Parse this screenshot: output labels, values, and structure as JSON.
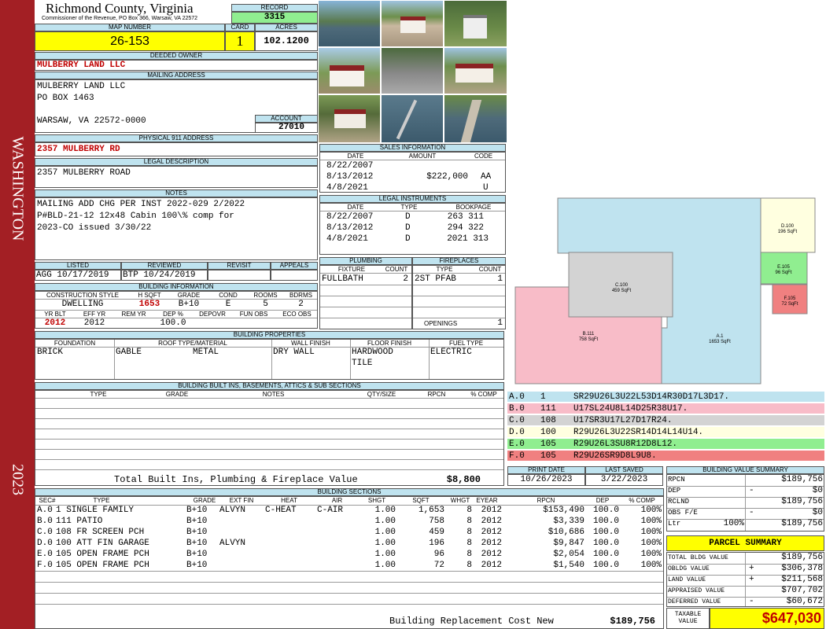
{
  "sidebar": {
    "district": "WASHINGTON",
    "year": "2023",
    "color": "#a31f24"
  },
  "header": {
    "county": "Richmond County, Virginia",
    "commissioner": "Commissioner of the Revenue, PO Box 366, Warsaw, VA 22572"
  },
  "record": {
    "label": "RECORD",
    "value": "3315"
  },
  "map": {
    "label": "MAP NUMBER",
    "value": "26-153"
  },
  "card": {
    "label": "CARD",
    "value": "1"
  },
  "acres": {
    "label": "ACRES",
    "value": "102.1200"
  },
  "owner": {
    "label": "DEEDED OWNER",
    "value": "MULBERRY LAND LLC"
  },
  "mailing": {
    "label": "MAILING ADDRESS",
    "line1": "MULBERRY LAND LLC",
    "line2": "PO BOX 1463",
    "line3": "WARSAW, VA 22572-0000"
  },
  "account": {
    "label": "ACCOUNT",
    "value": "27010"
  },
  "physical": {
    "label": "PHYSICAL 911 ADDRESS",
    "value": "2357 MULBERRY RD"
  },
  "legal": {
    "label": "LEGAL DESCRIPTION",
    "value": "2357 MULBERRY ROAD"
  },
  "notes": {
    "label": "NOTES",
    "line1": "MAILING ADD CHG PER INST 2022-029 2/2022",
    "line2": "P#BLD-21-12 12x48 Cabin 100\\% comp for",
    "line3": "2023-CO issued 3/30/22"
  },
  "sales": {
    "label": "SALES INFORMATION",
    "h_date": "DATE",
    "h_amount": "AMOUNT",
    "h_code": "CODE",
    "rows": [
      {
        "date": "8/22/2007",
        "amount": "",
        "code": ""
      },
      {
        "date": "8/13/2012",
        "amount": "$222,000",
        "code": "AA"
      },
      {
        "date": "4/8/2021",
        "amount": "",
        "code": "U"
      }
    ]
  },
  "instruments": {
    "label": "LEGAL INSTRUMENTS",
    "h_date": "DATE",
    "h_type": "TYPE",
    "h_book": "BOOKPAGE",
    "rows": [
      {
        "date": "8/22/2007",
        "type": "D",
        "book": "263 311"
      },
      {
        "date": "8/13/2012",
        "type": "D",
        "book": "294 322"
      },
      {
        "date": "4/8/2021",
        "type": "D",
        "book": "2021 313"
      }
    ]
  },
  "listed": {
    "label": "LISTED",
    "value": "AGG 10/17/2019"
  },
  "reviewed": {
    "label": "REVIEWED",
    "value": "BTP 10/24/2019"
  },
  "revisit": {
    "label": "REVISIT",
    "value": ""
  },
  "appeals": {
    "label": "APPEALS",
    "value": ""
  },
  "plumbing": {
    "label": "PLUMBING",
    "h_fixture": "FIXTURE",
    "h_count": "COUNT",
    "fixture": "FULLBATH",
    "count": "2"
  },
  "fireplaces": {
    "label": "FIREPLACES",
    "h_type": "TYPE",
    "h_count": "COUNT",
    "type": "2ST PFAB",
    "count": "1",
    "openings_label": "OPENINGS",
    "openings": "1"
  },
  "building_info": {
    "label": "BUILDING INFORMATION",
    "h_style": "CONSTRUCTION STYLE",
    "h_hsqft": "H SQFT",
    "h_grade": "GRADE",
    "h_cond": "COND",
    "h_rooms": "ROOMS",
    "h_bdrms": "BDRMS",
    "style": "DWELLING",
    "hsqft": "1653",
    "grade": "B+10",
    "cond": "E",
    "rooms": "5",
    "bdrms": "2",
    "h_yrblt": "YR BLT",
    "h_effyr": "EFF YR",
    "h_remyr": "REM YR",
    "h_dep": "DEP %",
    "h_depovr": "DEPOVR",
    "h_funobs": "FUN OBS",
    "h_ecoobs": "ECO OBS",
    "yrblt": "2012",
    "effyr": "2012",
    "remyr": "",
    "dep": "100.0",
    "depovr": "",
    "funobs": "",
    "ecoobs": ""
  },
  "properties": {
    "label": "BUILDING PROPERTIES",
    "h_foundation": "FOUNDATION",
    "h_roof": "ROOF TYPE/MATERIAL",
    "h_wall": "WALL FINISH",
    "h_floor": "FLOOR FINISH",
    "h_fuel": "FUEL TYPE",
    "foundation": "BRICK",
    "roof_type": "GABLE",
    "roof_material": "METAL",
    "wall": "DRY WALL",
    "floor1": "HARDWOOD",
    "floor2": "TILE",
    "fuel": "ELECTRIC"
  },
  "builtins": {
    "label": "BUILDING BUILT INS, BASEMENTS, ATTICS & SUB SECTIONS",
    "h_type": "TYPE",
    "h_grade": "GRADE",
    "h_notes": "NOTES",
    "h_qty": "QTY/SIZE",
    "h_rpcn": "RPCN",
    "h_comp": "% COMP",
    "total_label": "Total Built Ins, Plumbing & Fireplace Value",
    "total_value": "$8,800"
  },
  "print_date": {
    "label": "PRINT DATE",
    "value": "10/26/2023"
  },
  "last_saved": {
    "label": "LAST SAVED",
    "value": "3/22/2023"
  },
  "vectors": [
    {
      "sec": "A.0",
      "code": "1",
      "desc": "SR29U26L3U22L53D14R30D17L3D17.",
      "color": "#bfe3ef"
    },
    {
      "sec": "B.0",
      "code": "111",
      "desc": "U17SL24U8L14D25R38U17.",
      "color": "#f8bcc8"
    },
    {
      "sec": "C.0",
      "code": "108",
      "desc": "U17SR3U17L27D17R24.",
      "color": "#d3d3d3"
    },
    {
      "sec": "D.0",
      "code": "100",
      "desc": "R29U26L3U22SR14D14L14U14.",
      "color": "#ffffe0"
    },
    {
      "sec": "E.0",
      "code": "105",
      "desc": "R29U26L3SU8R12D8L12.",
      "color": "#90ee90"
    },
    {
      "sec": "F.0",
      "code": "105",
      "desc": "R29U26SR9D8L9U8.",
      "color": "#f08080"
    }
  ],
  "sketch": {
    "a_label": "A.1",
    "a_area": "1653 SqFt",
    "b_label": "B.111",
    "b_area": "758 SqFt",
    "c_label": "C.100",
    "c_area": "459 SqFt",
    "d_label": "D.100",
    "d_area": "196 SqFt",
    "e_label": "E.105",
    "e_area": "96 SqFt",
    "f_label": "F.105",
    "f_area": "72 SqFt"
  },
  "sections": {
    "label": "BUILDING SECTIONS",
    "headers": [
      "SEC#",
      "TYPE",
      "GRADE",
      "EXT FIN",
      "HEAT",
      "AIR",
      "SHGT",
      "SQFT",
      "WHGT",
      "EYEAR",
      "RPCN",
      "DEP",
      "% COMP"
    ],
    "rows": [
      [
        "A.0",
        "1 SINGLE FAMILY",
        "B+10",
        "ALVYN",
        "C-HEAT",
        "C-AIR",
        "1.00",
        "1,653",
        "8",
        "2012",
        "$153,490",
        "100.0",
        "100%"
      ],
      [
        "B.0",
        "111 PATIO",
        "B+10",
        "",
        "",
        "",
        "1.00",
        "758",
        "8",
        "2012",
        "$3,339",
        "100.0",
        "100%"
      ],
      [
        "C.0",
        "108 FR SCREEN PCH",
        "B+10",
        "",
        "",
        "",
        "1.00",
        "459",
        "8",
        "2012",
        "$10,686",
        "100.0",
        "100%"
      ],
      [
        "D.0",
        "100 ATT FIN GARAGE",
        "B+10",
        "ALVYN",
        "",
        "",
        "1.00",
        "196",
        "8",
        "2012",
        "$9,847",
        "100.0",
        "100%"
      ],
      [
        "E.0",
        "105 OPEN FRAME PCH",
        "B+10",
        "",
        "",
        "",
        "1.00",
        "96",
        "8",
        "2012",
        "$2,054",
        "100.0",
        "100%"
      ],
      [
        "F.0",
        "105 OPEN FRAME PCH",
        "B+10",
        "",
        "",
        "",
        "1.00",
        "72",
        "8",
        "2012",
        "$1,540",
        "100.0",
        "100%"
      ]
    ],
    "replacement_label": "Building Replacement Cost New",
    "replacement_value": "$189,756"
  },
  "value_summary": {
    "label": "BUILDING VALUE SUMMARY",
    "rows": [
      {
        "name": "RPCN",
        "pct": "",
        "sign": "",
        "value": "$189,756"
      },
      {
        "name": "DEP",
        "pct": "",
        "sign": "-",
        "value": "$0"
      },
      {
        "name": "RCLND",
        "pct": "",
        "sign": "",
        "value": "$189,756"
      },
      {
        "name": "OBS F/E",
        "pct": "",
        "sign": "-",
        "value": "$0"
      },
      {
        "name": "Ltr",
        "pct": "100%",
        "sign": "",
        "value": "$189,756"
      }
    ]
  },
  "parcel": {
    "label": "PARCEL SUMMARY",
    "rows": [
      {
        "name": "TOTAL BLDG VALUE",
        "sign": "",
        "value": "$189,756"
      },
      {
        "name": "OBLDG VALUE",
        "sign": "+",
        "value": "$306,378"
      },
      {
        "name": "LAND VALUE",
        "sign": "+",
        "value": "$211,568"
      },
      {
        "name": "APPRAISED VALUE",
        "sign": "",
        "value": "$707,702"
      },
      {
        "name": "DEFERRED VALUE",
        "sign": "-",
        "value": "$60,672"
      }
    ],
    "taxable_label1": "TAXABLE",
    "taxable_label2": "VALUE",
    "taxable_value": "$647,030"
  }
}
